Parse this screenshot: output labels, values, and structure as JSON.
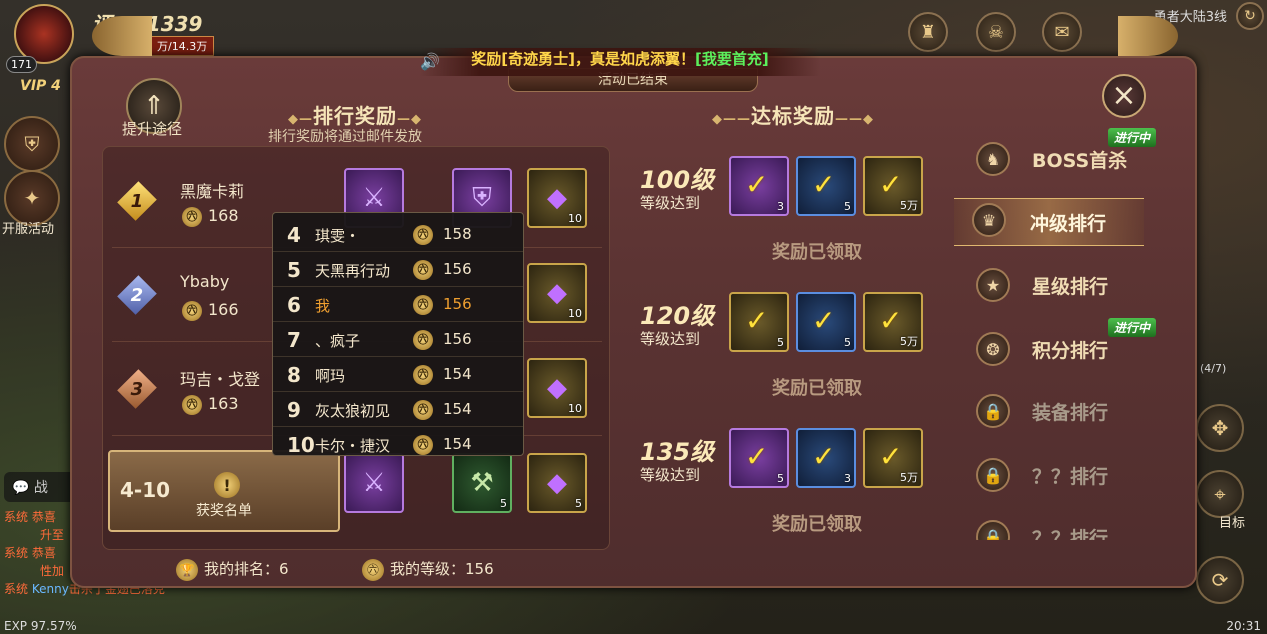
{
  "hud": {
    "score": "551339",
    "score_prefix": "评",
    "power": "万/14.3万",
    "vip": "VIP 4",
    "level": "171",
    "server": "勇者大陆3线",
    "open_event": "开服活动",
    "target": "目标",
    "exp": "EXP 97.57%",
    "time": "20:31",
    "side_counter": "(4/7)"
  },
  "chat": {
    "button": "战",
    "lines": [
      {
        "tag": "系统",
        "text": "恭喜",
        "hl": ""
      },
      {
        "tag": "",
        "text": "升至",
        "hl": ""
      },
      {
        "tag": "系统",
        "text": "恭喜",
        "hl": ""
      },
      {
        "tag": "",
        "text": "性加",
        "hl": ""
      },
      {
        "tag": "系统",
        "name": "Kenny",
        "text": "击杀了金翅巴洛克"
      }
    ]
  },
  "banner": {
    "prefix": "奖励[奇迹勇士]，真是如虎添翼！",
    "link": "[我要首充]"
  },
  "status": "活动已结束",
  "raise": {
    "label": "提升途径"
  },
  "ranking": {
    "title": "排行奖励",
    "subtitle": "排行奖励将通过邮件发放",
    "rows": [
      {
        "rank": "1",
        "name": "黑魔卡莉",
        "level": "168",
        "reward_count": "10"
      },
      {
        "rank": "2",
        "name": "Ybaby",
        "level": "166",
        "reward_count": "10"
      },
      {
        "rank": "3",
        "name": "玛吉・戈登",
        "level": "163",
        "reward_count": "10"
      }
    ],
    "selected": {
      "range": "4-10",
      "winners": "获奖名单",
      "counts": [
        "5",
        "5"
      ]
    },
    "popup": [
      {
        "rank": "4",
        "name": "琪雯・",
        "level": "158"
      },
      {
        "rank": "5",
        "name": "天黑再行动",
        "level": "156"
      },
      {
        "rank": "6",
        "name": "我",
        "level": "156"
      },
      {
        "rank": "7",
        "name": "、疯子",
        "level": "156"
      },
      {
        "rank": "8",
        "name": "啊玛",
        "level": "154"
      },
      {
        "rank": "9",
        "name": "灰太狼初见",
        "level": "154"
      },
      {
        "rank": "10",
        "name": "卡尔・捷汉",
        "level": "154"
      }
    ],
    "my_rank": "我的排名：6",
    "my_level": "我的等级：156"
  },
  "milestones": {
    "title": "达标奖励",
    "claimed": "奖励已领取",
    "items": [
      {
        "level": "100级",
        "sub": "等级达到",
        "counts": [
          "3",
          "5",
          "5万"
        ]
      },
      {
        "level": "120级",
        "sub": "等级达到",
        "counts": [
          "5",
          "5",
          "5万"
        ]
      },
      {
        "level": "135级",
        "sub": "等级达到",
        "counts": [
          "5",
          "3",
          "5万"
        ]
      }
    ]
  },
  "tabs": [
    {
      "label": "BOSS首杀",
      "badge": "进行中"
    },
    {
      "label": "冲级排行",
      "badge": ""
    },
    {
      "label": "星级排行",
      "badge": ""
    },
    {
      "label": "积分排行",
      "badge": "进行中"
    },
    {
      "label": "装备排行",
      "badge": ""
    },
    {
      "label": "？？排行",
      "badge": ""
    },
    {
      "label": "？？排行",
      "badge": ""
    }
  ],
  "icons": {
    "level": "lv-icon",
    "trophy": "trophy-icon"
  }
}
